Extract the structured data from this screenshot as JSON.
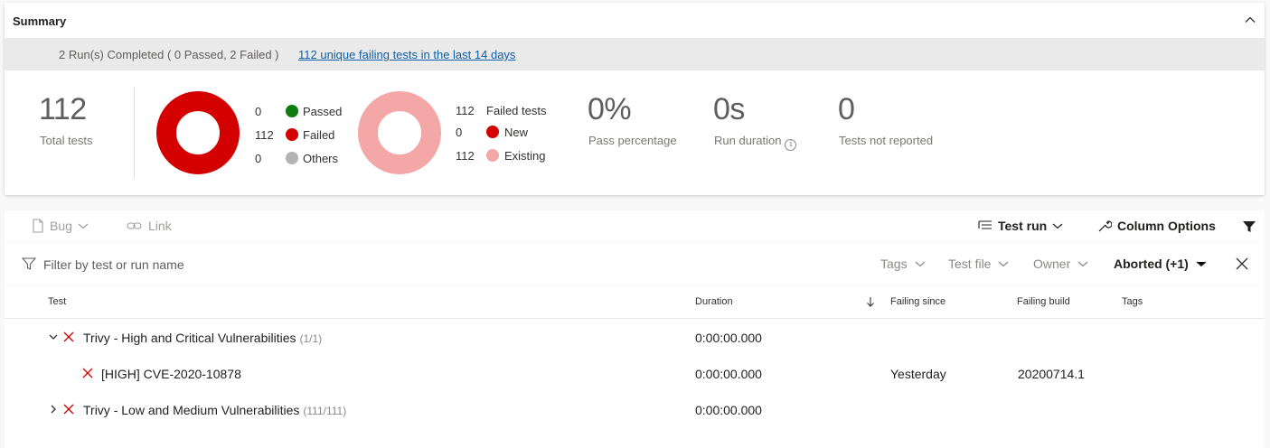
{
  "summary": {
    "title": "Summary",
    "banner_text": "2 Run(s) Completed ( 0 Passed, 2 Failed )",
    "banner_link": "112 unique failing tests in the last 14 days",
    "total_tests": {
      "value": "112",
      "label": "Total tests"
    },
    "outcome_legend": [
      {
        "count": "0",
        "label": "Passed",
        "color": "#107c10"
      },
      {
        "count": "112",
        "label": "Failed",
        "color": "#d40000"
      },
      {
        "count": "0",
        "label": "Others",
        "color": "#b3b3b3"
      }
    ],
    "failed_legend": {
      "header_count": "112",
      "header_label": "Failed tests",
      "items": [
        {
          "count": "0",
          "label": "New",
          "color": "#d40000"
        },
        {
          "count": "112",
          "label": "Existing",
          "color": "#f4a7a7"
        }
      ]
    },
    "pass_percentage": {
      "value": "0%",
      "label": "Pass percentage"
    },
    "run_duration": {
      "value": "0s",
      "label": "Run duration"
    },
    "not_reported": {
      "value": "0",
      "label": "Tests not reported"
    }
  },
  "toolbar": {
    "bug_label": "Bug",
    "link_label": "Link",
    "group_label": "Test run",
    "column_options_label": "Column Options"
  },
  "filter": {
    "placeholder": "Filter by test or run name",
    "chips": [
      "Tags",
      "Test file",
      "Owner"
    ],
    "active_chip": "Aborted (+1)"
  },
  "grid": {
    "columns": {
      "test": "Test",
      "duration": "Duration",
      "failing_since": "Failing since",
      "failing_build": "Failing build",
      "tags": "Tags"
    },
    "rows": [
      {
        "name": "Trivy - High and Critical Vulnerabilities",
        "count": "(1/1)",
        "duration": "0:00:00.000",
        "failing_since": "",
        "failing_build": "",
        "expanded": true
      },
      {
        "name": "[HIGH] CVE-2020-10878",
        "count": "",
        "duration": "0:00:00.000",
        "failing_since": "Yesterday",
        "failing_build": "20200714.1"
      },
      {
        "name": "Trivy - Low and Medium Vulnerabilities",
        "count": "(111/111)",
        "duration": "0:00:00.000",
        "failing_since": "",
        "failing_build": "",
        "expanded": false
      }
    ]
  },
  "icons": {
    "collapse": "chevron-up-icon",
    "bug": "bug-icon",
    "link": "link-icon",
    "group": "group-by-icon",
    "wrench": "wrench-icon",
    "filter": "filter-icon",
    "close": "close-icon",
    "fail": "fail-x-icon",
    "sort": "sort-down-arrow-icon",
    "info": "info-icon"
  }
}
